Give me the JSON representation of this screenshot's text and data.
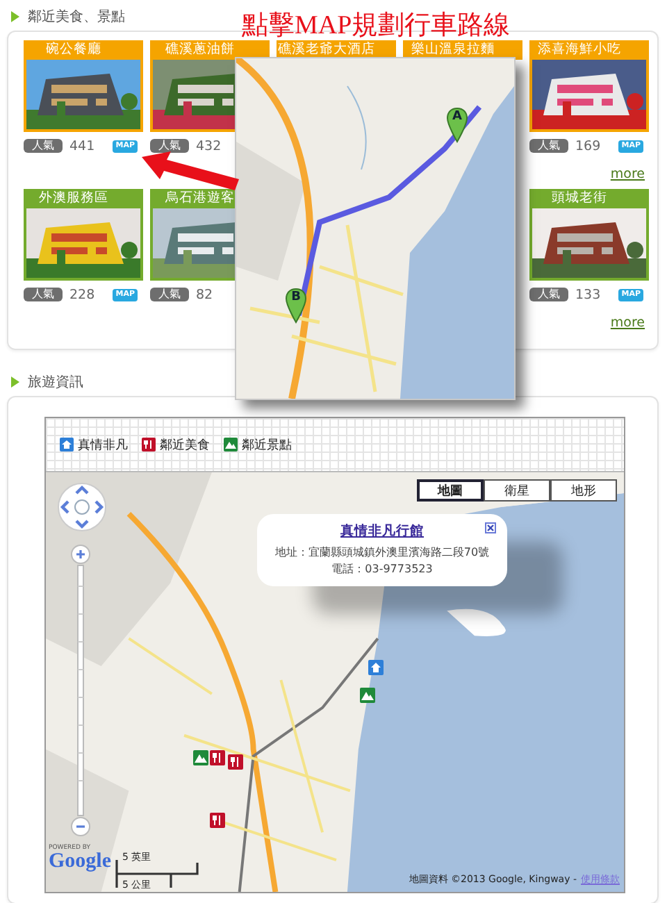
{
  "nearby": {
    "title": "鄰近美食、景點",
    "rows": [
      {
        "kind": "food",
        "more": "more",
        "cards": [
          {
            "kind": "card",
            "title": "碗公餐廳",
            "photo": true,
            "popularity": "人氣",
            "count": "441",
            "map": "MAP"
          },
          {
            "kind": "card",
            "title": "礁溪蔥油餅",
            "photo": true,
            "popularity": "人氣",
            "count": "432"
          },
          {
            "kind": "card",
            "title": "礁溪老爺大酒店"
          },
          {
            "kind": "card",
            "title": "樂山溫泉拉麵"
          },
          {
            "kind": "card",
            "title": "添喜海鮮小吃",
            "photo": true,
            "popularity": "人氣",
            "count": "169",
            "map": "MAP"
          }
        ]
      },
      {
        "kind": "scenery",
        "more": "more",
        "cards": [
          {
            "kind": "card",
            "title": "外澳服務區",
            "photo": true,
            "popularity": "人氣",
            "count": "228",
            "map": "MAP"
          },
          {
            "kind": "card",
            "title": "烏石港遊客",
            "photo": true,
            "popularity": "人氣",
            "count": "82"
          },
          {
            "kind": "covered"
          },
          {
            "kind": "covered"
          },
          {
            "kind": "card",
            "title": "頭城老街",
            "photo": true,
            "popularity": "人氣",
            "count": "133",
            "map": "MAP"
          }
        ]
      }
    ]
  },
  "route_hint": {
    "title": "點擊MAP規劃行車路線",
    "markers": [
      "A",
      "B"
    ]
  },
  "travel": {
    "title": "旅遊資訊",
    "legend": [
      {
        "kind": "home",
        "label": "真情非凡"
      },
      {
        "kind": "food",
        "label": "鄰近美食"
      },
      {
        "kind": "scenery",
        "label": "鄰近景點"
      }
    ],
    "map_types": [
      {
        "label": "地圖",
        "selected": true
      },
      {
        "label": "衛星",
        "selected": false
      },
      {
        "label": "地形",
        "selected": false
      }
    ],
    "info_window": {
      "title": "真情非凡行館",
      "address": "地址：宜蘭縣頭城鎮外澳里濱海路二段70號",
      "phone": "電話：03-9773523"
    },
    "markers": [
      {
        "kind": "home"
      },
      {
        "kind": "scenery"
      },
      {
        "kind": "scenery"
      },
      {
        "kind": "food"
      },
      {
        "kind": "food"
      },
      {
        "kind": "food"
      }
    ],
    "powered_by": "POWERED BY",
    "logo": "Google",
    "scale": [
      "5 英里",
      "5 公里"
    ],
    "attribution": "地圖資料 ©2013 Google, Kingway -",
    "terms": "使用條款"
  }
}
